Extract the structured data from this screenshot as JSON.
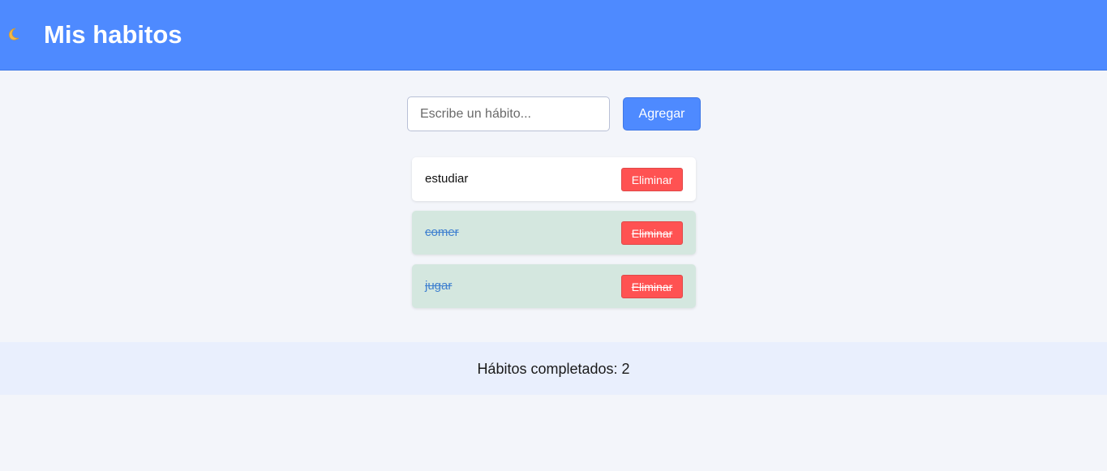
{
  "header": {
    "title": "Mis habitos",
    "icon": "crescent-moon-icon",
    "background": "#4e8aff"
  },
  "form": {
    "input_placeholder": "Escribe un hábito...",
    "input_value": "",
    "add_label": "Agregar"
  },
  "habits": [
    {
      "name": "estudiar",
      "completed": false,
      "delete_label": "Eliminar"
    },
    {
      "name": "comer",
      "completed": true,
      "delete_label": "Eliminar"
    },
    {
      "name": "jugar",
      "completed": true,
      "delete_label": "Eliminar"
    }
  ],
  "footer": {
    "summary": "Hábitos completados: 2"
  },
  "colors": {
    "accent": "#4e8aff",
    "danger": "#ff5252",
    "completed_bg": "#d4e7df",
    "completed_text": "#3e7fcf"
  }
}
